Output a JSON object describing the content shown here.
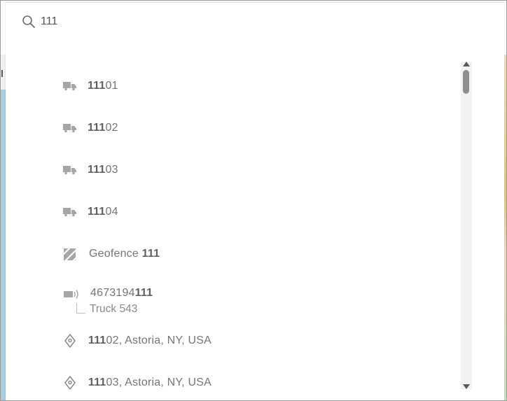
{
  "search": {
    "value": "111",
    "icon": "search-icon"
  },
  "results": [
    {
      "type": "vehicle",
      "icon": "truck-icon",
      "match": "111",
      "rest": "01"
    },
    {
      "type": "vehicle",
      "icon": "truck-icon",
      "match": "111",
      "rest": "02"
    },
    {
      "type": "vehicle",
      "icon": "truck-icon",
      "match": "111",
      "rest": "03"
    },
    {
      "type": "vehicle",
      "icon": "truck-icon",
      "match": "111",
      "rest": "04"
    },
    {
      "type": "geofence",
      "icon": "geofence-icon",
      "prefix": "Geofence ",
      "match": "111"
    },
    {
      "type": "device",
      "icon": "tracker-device-icon",
      "prefix": "4673194",
      "match": "111",
      "sub": "Truck 543"
    },
    {
      "type": "address",
      "icon": "location-pin-icon",
      "match": "111",
      "rest": "02, Astoria, NY, USA"
    },
    {
      "type": "address",
      "icon": "location-pin-icon",
      "match": "111",
      "rest": "03, Astoria, NY, USA"
    }
  ],
  "colors": {
    "icon": "#a6a6a6",
    "text": "#757575",
    "match": "#606060",
    "scroll_thumb": "#8e8e8e"
  }
}
